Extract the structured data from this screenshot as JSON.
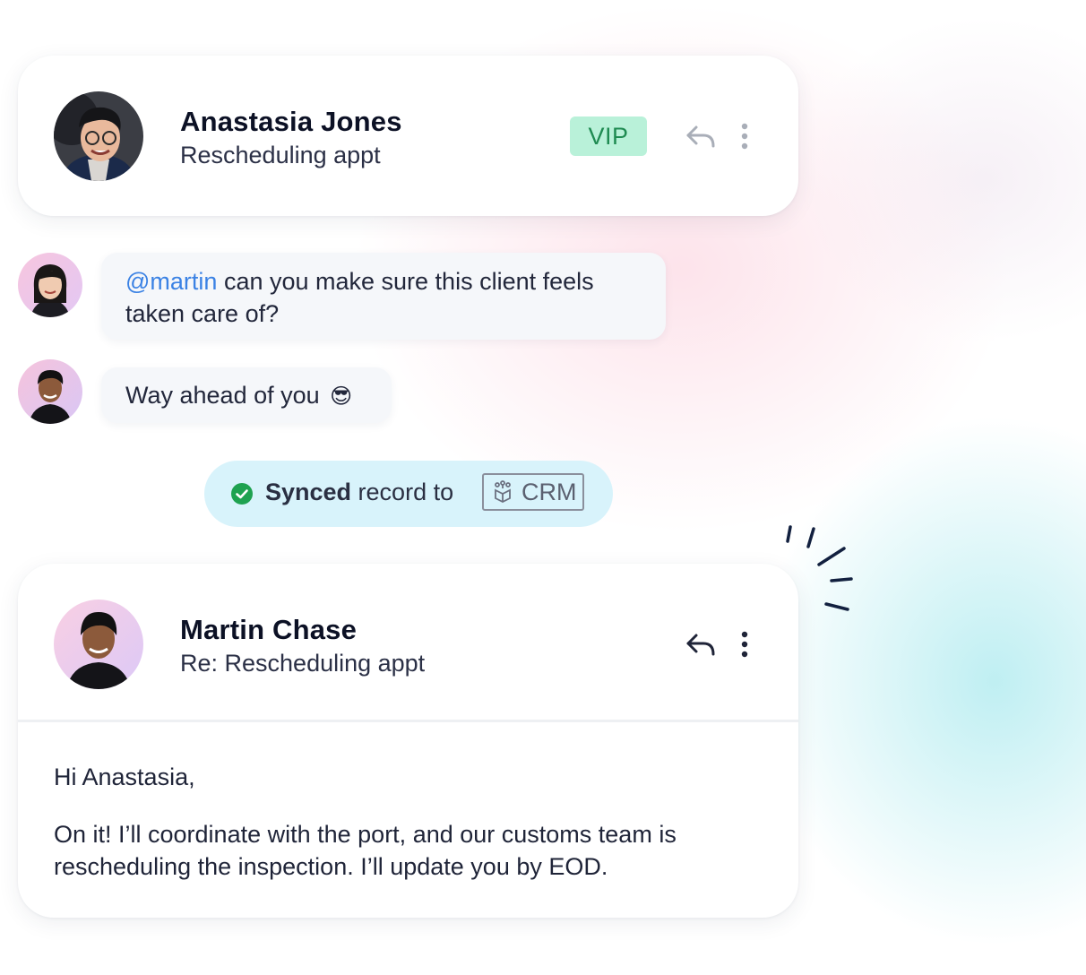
{
  "top_card": {
    "name": "Anastasia Jones",
    "subject": "Rescheduling appt",
    "badge": "VIP",
    "avatar_icon": "avatar-anastasia",
    "reply_icon": "reply-icon",
    "more_icon": "more-vertical-icon"
  },
  "comments": [
    {
      "mention": "@martin",
      "text_line1": " can you make sure this client feels",
      "text_line2": "taken care of?",
      "avatar_icon": "avatar-teammate"
    },
    {
      "text": "Way ahead of you",
      "emoji": "😎",
      "avatar_icon": "avatar-martin"
    }
  ],
  "sync": {
    "bold": "Synced",
    "text": " record to ",
    "target": "CRM",
    "check_icon": "check-circle-icon",
    "crm_icon": "crm-cube-icon"
  },
  "bottom_card": {
    "name": "Martin Chase",
    "subject": "Re: Rescheduling appt",
    "greeting": "Hi Anastasia,",
    "body_line1": "On it! I’ll coordinate with the port, and our customs team is",
    "body_line2": "rescheduling the inspection. I’ll update you by EOD."
  },
  "colors": {
    "vip_bg": "#b9f1d9",
    "vip_text": "#1f8b52",
    "mention": "#3b82e4",
    "sync_bg": "#d8f3fb",
    "check": "#1ea250"
  }
}
